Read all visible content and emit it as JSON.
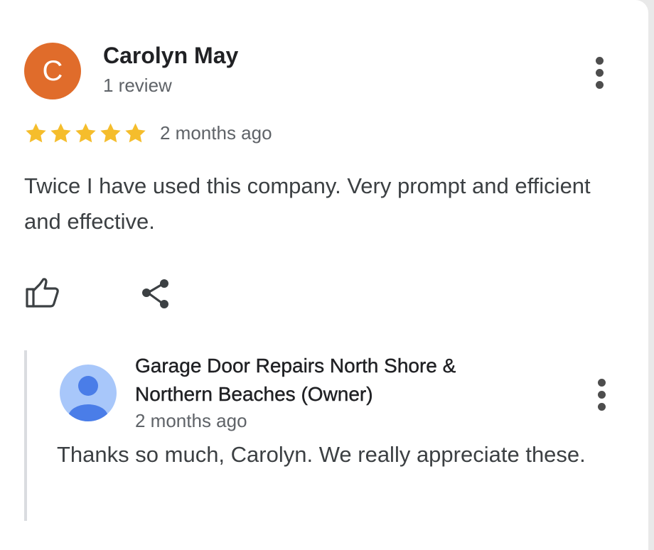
{
  "review": {
    "avatar_initial": "C",
    "avatar_color": "#e06c2b",
    "reviewer_name": "Carolyn May",
    "review_count": "1 review",
    "rating": 5,
    "rating_max": 5,
    "star_color": "#f5bd2c",
    "time": "2 months ago",
    "text": "Twice I have used this company. Very prompt and efficient and effective.",
    "more_icon": "more-vertical-icon"
  },
  "actions": {
    "like_icon": "thumbs-up-icon",
    "share_icon": "share-icon"
  },
  "owner_reply": {
    "avatar_icon": "default-person-avatar-icon",
    "avatar_color": "#a8c7fa",
    "name": "Garage Door Repairs North Shore & Northern Beaches (Owner)",
    "time": "2 months ago",
    "text": "Thanks so much, Carolyn. We really appreciate these.",
    "more_icon": "more-vertical-icon"
  }
}
